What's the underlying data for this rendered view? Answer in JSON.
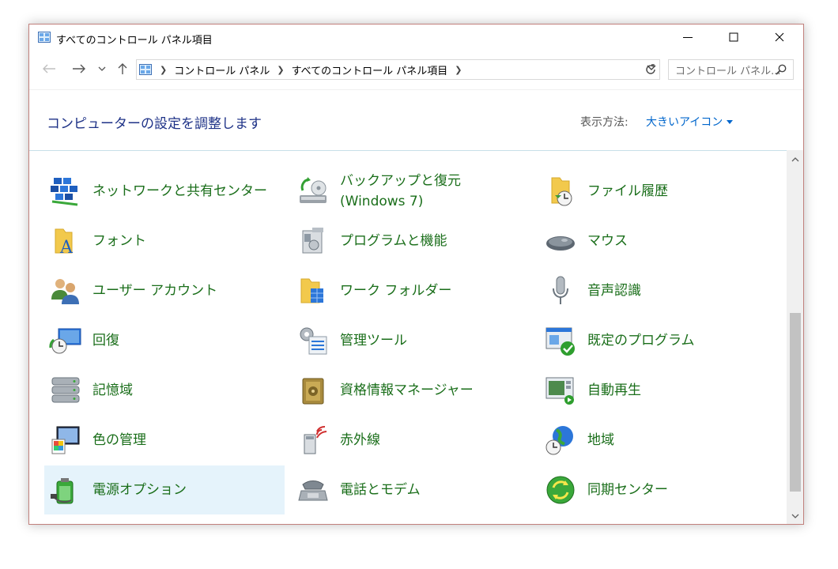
{
  "window": {
    "title": "すべてのコントロール パネル項目"
  },
  "navigation": {
    "breadcrumb": [
      "コントロール パネル",
      "すべてのコントロール パネル項目"
    ],
    "search_placeholder": "コントロール パネル..."
  },
  "header": {
    "title": "コンピューターの設定を調整します",
    "view_label": "表示方法:",
    "view_value": "大きいアイコン"
  },
  "items": [
    {
      "label": "ネットワークと共有センター",
      "icon": "network-icon"
    },
    {
      "label": "バックアップと復元 (Windows 7)",
      "icon": "backup-icon"
    },
    {
      "label": "ファイル履歴",
      "icon": "file-history-icon"
    },
    {
      "label": "フォント",
      "icon": "font-icon"
    },
    {
      "label": "プログラムと機能",
      "icon": "programs-icon"
    },
    {
      "label": "マウス",
      "icon": "mouse-icon"
    },
    {
      "label": "ユーザー アカウント",
      "icon": "users-icon"
    },
    {
      "label": "ワーク フォルダー",
      "icon": "work-folder-icon"
    },
    {
      "label": "音声認識",
      "icon": "microphone-icon"
    },
    {
      "label": "回復",
      "icon": "recovery-icon"
    },
    {
      "label": "管理ツール",
      "icon": "admin-tools-icon"
    },
    {
      "label": "既定のプログラム",
      "icon": "default-programs-icon"
    },
    {
      "label": "記憶域",
      "icon": "storage-icon"
    },
    {
      "label": "資格情報マネージャー",
      "icon": "credential-icon"
    },
    {
      "label": "自動再生",
      "icon": "autoplay-icon"
    },
    {
      "label": "色の管理",
      "icon": "color-management-icon"
    },
    {
      "label": "赤外線",
      "icon": "infrared-icon"
    },
    {
      "label": "地域",
      "icon": "region-icon"
    },
    {
      "label": "電源オプション",
      "icon": "power-icon"
    },
    {
      "label": "電話とモデム",
      "icon": "phone-modem-icon"
    },
    {
      "label": "同期センター",
      "icon": "sync-center-icon"
    }
  ],
  "selected_item": "電源オプション",
  "colors": {
    "item_text": "#1a6e1a",
    "title_text": "#1e3287",
    "link": "#0066cc",
    "selection": "#e5f3fb"
  }
}
